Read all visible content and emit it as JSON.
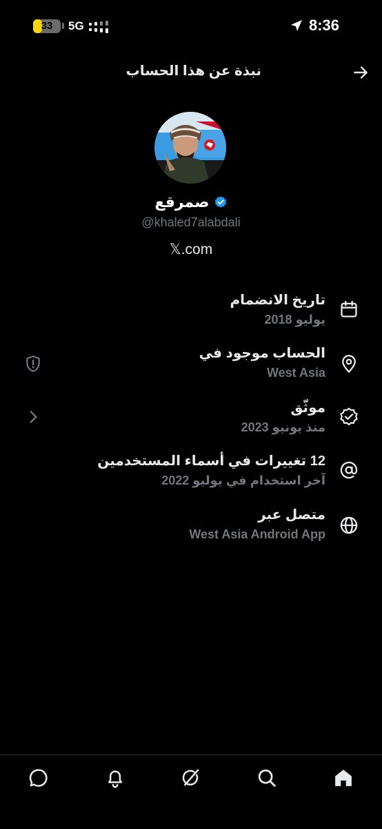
{
  "status_bar": {
    "battery_percent": "33",
    "battery_level": 0.33,
    "network": "5G",
    "time": "8:36"
  },
  "header": {
    "title": "نبذة عن هذا الحساب",
    "back_icon": "arrow-right-icon"
  },
  "profile": {
    "display_name": "صمرقع",
    "handle": "@khaled7alabdali",
    "website": "𝕏.com",
    "verified_color": "#1d9bf0"
  },
  "about_rows": [
    {
      "title": "تاريخ الانضمام",
      "subtitle": "يوليو 2018",
      "icon": "calendar-icon"
    },
    {
      "title": "الحساب موجود في",
      "subtitle": "West Asia",
      "icon": "location-pin-icon",
      "left_icon": "shield-alert-icon"
    },
    {
      "title": "موثّق",
      "subtitle": "منذ يونيو 2023",
      "icon": "verified-badge-icon",
      "left_icon": "chevron-icon"
    },
    {
      "title": "12 تغييرات في أسماء المستخدمين",
      "subtitle": "آخر استخدام في يوليو 2022",
      "icon": "at-sign-icon"
    },
    {
      "title": "متصل عبر",
      "subtitle": "West Asia Android App",
      "icon": "globe-icon"
    }
  ],
  "bottom_nav": [
    "chat-icon",
    "bell-icon",
    "grok-icon",
    "search-icon",
    "home-icon"
  ]
}
